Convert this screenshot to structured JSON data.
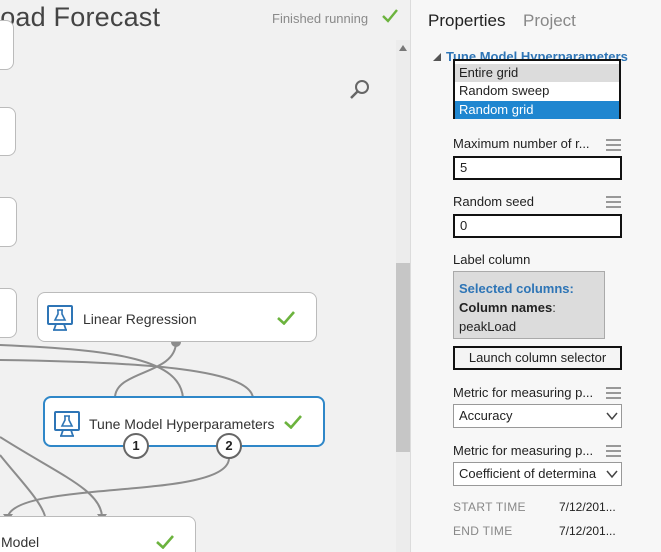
{
  "experiment": {
    "title": "load Forecast",
    "status": "Finished running",
    "status_color": "#6cb33e"
  },
  "modules": {
    "linear_regression": {
      "label": "Linear Regression",
      "icon": "flask-monitor-icon"
    },
    "tune_model": {
      "label": "Tune Model Hyperparameters",
      "icon": "flask-monitor-icon",
      "ports": [
        "1",
        "2"
      ]
    },
    "bottom_model": {
      "label": "Model"
    }
  },
  "panel": {
    "tabs": [
      "Properties",
      "Project"
    ],
    "section_title": "Tune Model Hyperparameters",
    "sweep_options": [
      {
        "label": "Entire grid",
        "state": "hover"
      },
      {
        "label": "Random sweep",
        "state": "normal"
      },
      {
        "label": "Random grid",
        "state": "selected"
      }
    ],
    "max_runs_label": "Maximum number of r...",
    "max_runs_value": "5",
    "seed_label": "Random seed",
    "seed_value": "0",
    "label_column_label": "Label column",
    "selected_columns_title": "Selected columns:",
    "column_names_key": "Column names",
    "column_names_sep": ":",
    "column_names_value": "peakLoad",
    "launch_button": "Launch column selector",
    "metric1_label": "Metric for measuring p...",
    "metric1_value": "Accuracy",
    "metric2_label": "Metric for measuring p...",
    "metric2_value": "Coefficient of determina",
    "start_time_label": "START TIME",
    "start_time_value": "7/12/201...",
    "end_time_label": "END TIME",
    "end_time_value": "7/12/201..."
  },
  "colors": {
    "accent": "#2e75b6",
    "selection": "#1f86d0",
    "check": "#6cb33e",
    "module_selected_border": "#2f87c8"
  }
}
